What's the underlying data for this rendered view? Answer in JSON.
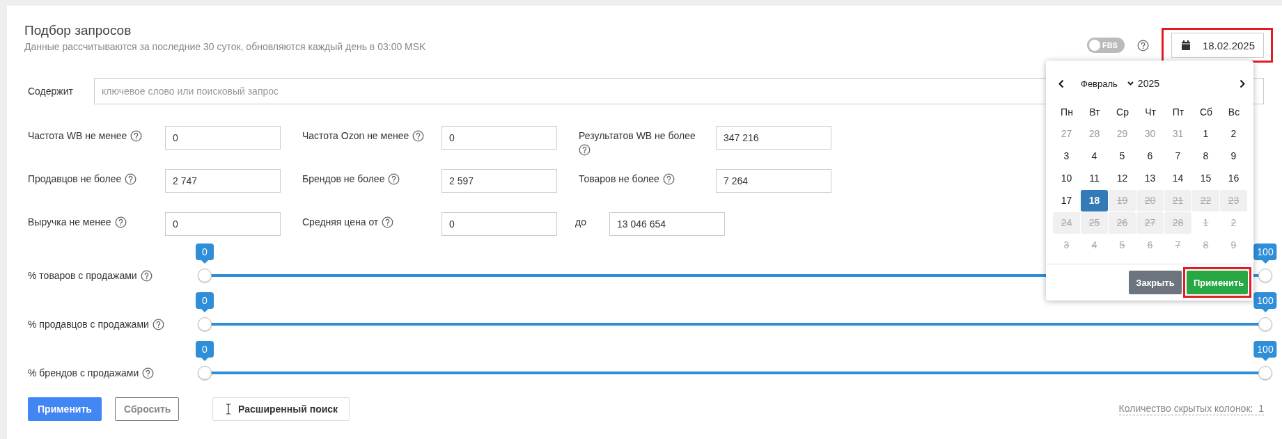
{
  "header": {
    "title": "Подбор запросов",
    "subtitle": "Данные рассчитываются за последние 30 суток, обновляются каждый день в 03:00 MSK",
    "fbs_toggle": {
      "label": "FBS",
      "on": false
    },
    "date_field": {
      "value": "18.02.2025",
      "highlighted": true
    }
  },
  "search": {
    "label": "Содержит",
    "placeholder": "ключевое слово или поисковый запрос"
  },
  "filter_rows": [
    {
      "fields": [
        {
          "kind": "filter",
          "label": "Частота WB не менее",
          "help": true,
          "value": "0"
        },
        {
          "kind": "filter",
          "label": "Частота Ozon не менее",
          "help": true,
          "value": "0"
        },
        {
          "kind": "filter",
          "label": "Результатов WB не более",
          "help": true,
          "value": "347 216"
        }
      ]
    },
    {
      "fields": [
        {
          "kind": "filter",
          "label": "Продавцов не более",
          "help": true,
          "value": "2 747"
        },
        {
          "kind": "filter",
          "label": "Брендов не более",
          "help": true,
          "value": "2 597"
        },
        {
          "kind": "filter",
          "label": "Товаров не более",
          "help": true,
          "value": "7 264"
        }
      ]
    },
    {
      "fields": [
        {
          "kind": "filter",
          "label": "Выручка не менее",
          "help": true,
          "value": "0"
        },
        {
          "kind": "filter",
          "label": "Средняя цена от",
          "help": true,
          "value": "0"
        },
        {
          "kind": "range-end",
          "label": "до",
          "help": false,
          "value": "13 046 654"
        }
      ]
    }
  ],
  "sliders": [
    {
      "label": "% товаров с продажами",
      "help": true,
      "low": {
        "level": 0,
        "reading": "0"
      },
      "high": {
        "level": 1,
        "reading": "100"
      }
    },
    {
      "label": "% продавцов с продажами",
      "help": true,
      "low": {
        "level": 0,
        "reading": "0"
      },
      "high": {
        "level": 1,
        "reading": "100"
      }
    },
    {
      "label": "% брендов с продажами",
      "help": true,
      "low": {
        "level": 0,
        "reading": "0"
      },
      "high": {
        "level": 1,
        "reading": "100"
      }
    }
  ],
  "actions": {
    "apply": "Применить",
    "reset": "Сбросить",
    "advanced": "Расширенный поиск"
  },
  "hidden_columns": {
    "label": "Количество скрытых колонок:",
    "count": "1"
  },
  "datepicker": {
    "month": "Февраль",
    "year": "2025",
    "weekdays": [
      "Пн",
      "Вт",
      "Ср",
      "Чт",
      "Пт",
      "Сб",
      "Вс"
    ],
    "days": [
      {
        "label": "27",
        "outside": true,
        "disabled": false,
        "selected": false
      },
      {
        "label": "28",
        "outside": true,
        "disabled": false,
        "selected": false
      },
      {
        "label": "29",
        "outside": true,
        "disabled": false,
        "selected": false
      },
      {
        "label": "30",
        "outside": true,
        "disabled": false,
        "selected": false
      },
      {
        "label": "31",
        "outside": true,
        "disabled": false,
        "selected": false
      },
      {
        "label": "1",
        "outside": false,
        "disabled": false,
        "selected": false
      },
      {
        "label": "2",
        "outside": false,
        "disabled": false,
        "selected": false
      },
      {
        "label": "3",
        "outside": false,
        "disabled": false,
        "selected": false
      },
      {
        "label": "4",
        "outside": false,
        "disabled": false,
        "selected": false
      },
      {
        "label": "5",
        "outside": false,
        "disabled": false,
        "selected": false
      },
      {
        "label": "6",
        "outside": false,
        "disabled": false,
        "selected": false
      },
      {
        "label": "7",
        "outside": false,
        "disabled": false,
        "selected": false
      },
      {
        "label": "8",
        "outside": false,
        "disabled": false,
        "selected": false
      },
      {
        "label": "9",
        "outside": false,
        "disabled": false,
        "selected": false
      },
      {
        "label": "10",
        "outside": false,
        "disabled": false,
        "selected": false
      },
      {
        "label": "11",
        "outside": false,
        "disabled": false,
        "selected": false
      },
      {
        "label": "12",
        "outside": false,
        "disabled": false,
        "selected": false
      },
      {
        "label": "13",
        "outside": false,
        "disabled": false,
        "selected": false
      },
      {
        "label": "14",
        "outside": false,
        "disabled": false,
        "selected": false
      },
      {
        "label": "15",
        "outside": false,
        "disabled": false,
        "selected": false
      },
      {
        "label": "16",
        "outside": false,
        "disabled": false,
        "selected": false
      },
      {
        "label": "17",
        "outside": false,
        "disabled": false,
        "selected": false
      },
      {
        "label": "18",
        "outside": false,
        "disabled": false,
        "selected": true
      },
      {
        "label": "19",
        "outside": false,
        "disabled": true,
        "selected": false
      },
      {
        "label": "20",
        "outside": false,
        "disabled": true,
        "selected": false
      },
      {
        "label": "21",
        "outside": false,
        "disabled": true,
        "selected": false
      },
      {
        "label": "22",
        "outside": false,
        "disabled": true,
        "selected": false
      },
      {
        "label": "23",
        "outside": false,
        "disabled": true,
        "selected": false
      },
      {
        "label": "24",
        "outside": false,
        "disabled": true,
        "selected": false
      },
      {
        "label": "25",
        "outside": false,
        "disabled": true,
        "selected": false
      },
      {
        "label": "26",
        "outside": false,
        "disabled": true,
        "selected": false
      },
      {
        "label": "27",
        "outside": false,
        "disabled": true,
        "selected": false
      },
      {
        "label": "28",
        "outside": false,
        "disabled": true,
        "selected": false
      },
      {
        "label": "1",
        "outside": true,
        "disabled": true,
        "selected": false
      },
      {
        "label": "2",
        "outside": true,
        "disabled": true,
        "selected": false
      },
      {
        "label": "3",
        "outside": true,
        "disabled": true,
        "selected": false
      },
      {
        "label": "4",
        "outside": true,
        "disabled": true,
        "selected": false
      },
      {
        "label": "5",
        "outside": true,
        "disabled": true,
        "selected": false
      },
      {
        "label": "6",
        "outside": true,
        "disabled": true,
        "selected": false
      },
      {
        "label": "7",
        "outside": true,
        "disabled": true,
        "selected": false
      },
      {
        "label": "8",
        "outside": true,
        "disabled": true,
        "selected": false
      },
      {
        "label": "9",
        "outside": true,
        "disabled": true,
        "selected": false
      }
    ],
    "close": "Закрыть",
    "apply": {
      "label": "Применить",
      "highlighted": true
    }
  }
}
